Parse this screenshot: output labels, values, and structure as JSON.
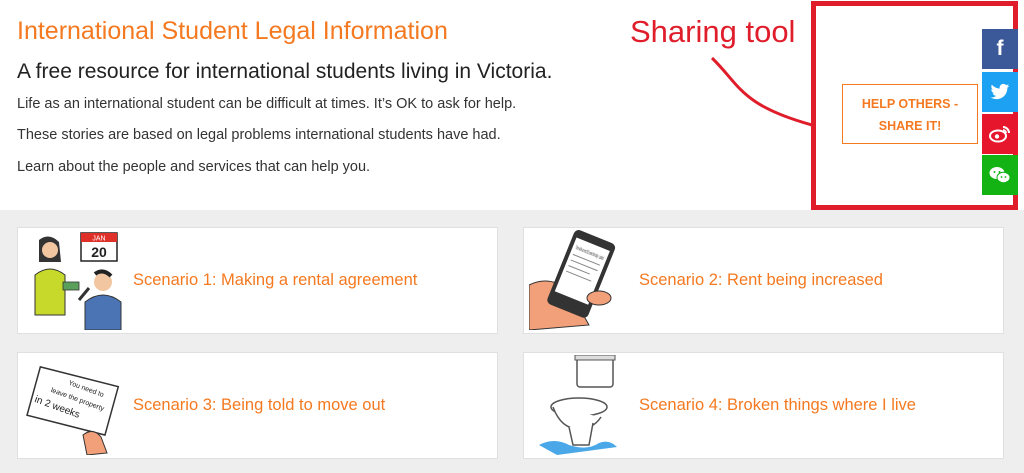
{
  "header": {
    "title": "International Student Legal Information",
    "subtitle": "A free resource for international students living in Victoria.",
    "paragraphs": [
      "Life as an international student can be difficult at times. It’s OK to ask for help.",
      "These stories are based on legal problems international students have had.",
      "Learn about the people and services that can help you."
    ]
  },
  "annotation": {
    "label": "Sharing tool"
  },
  "share": {
    "button_line1": "HELP OTHERS -",
    "button_line2": "SHARE IT!",
    "networks": [
      {
        "name": "facebook",
        "icon": "facebook-icon",
        "color": "#3b5998",
        "glyph": "f"
      },
      {
        "name": "twitter",
        "icon": "twitter-icon",
        "color": "#1da1f2"
      },
      {
        "name": "weibo",
        "icon": "weibo-icon",
        "color": "#e6162d"
      },
      {
        "name": "wechat",
        "icon": "wechat-icon",
        "color": "#12b312"
      }
    ]
  },
  "illustrations": {
    "calendar_month": "JAN",
    "calendar_day": "20",
    "phone_text": "There will be an extra $10 a week from today. - Landlord",
    "notice_text_1": "You need to",
    "notice_text_2": "leave the property",
    "notice_text_3": "in 2 weeks"
  },
  "scenarios": [
    {
      "label": "Scenario 1: Making a rental agreement"
    },
    {
      "label": "Scenario 2: Rent being increased"
    },
    {
      "label": "Scenario 3: Being told to move out"
    },
    {
      "label": "Scenario 4: Broken things where I live"
    }
  ],
  "colors": {
    "accent": "#f47920",
    "annotation": "#e01e2b",
    "grid_bg": "#eeeeee"
  }
}
